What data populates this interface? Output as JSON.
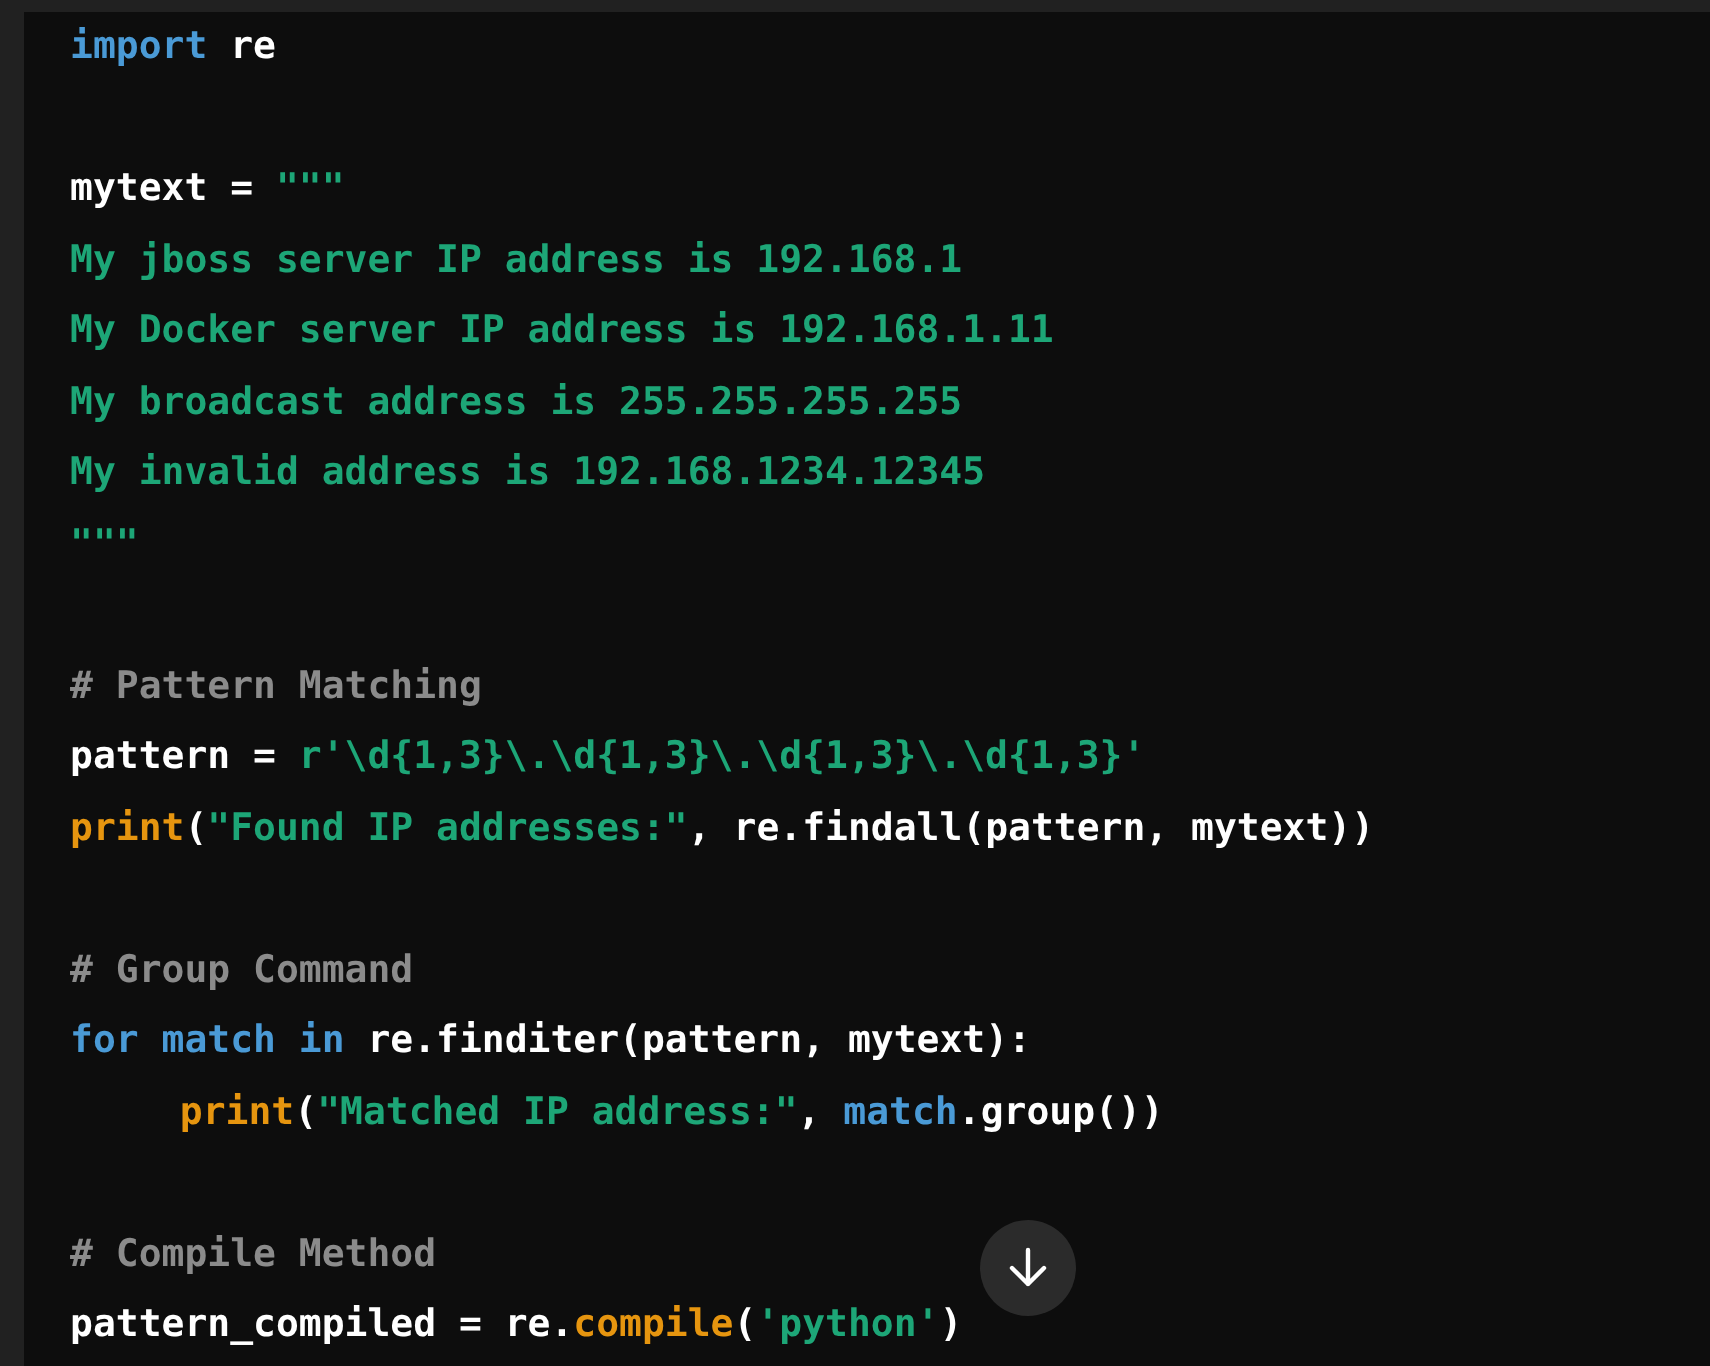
{
  "code": {
    "lines": [
      {
        "kind": "code",
        "tokens": [
          {
            "kind": "keyword",
            "text": "import"
          },
          {
            "kind": "plain",
            "text": " re"
          }
        ]
      },
      {
        "kind": "blank"
      },
      {
        "kind": "code",
        "tokens": [
          {
            "kind": "plain",
            "text": "mytext = "
          },
          {
            "kind": "string",
            "text": "\"\"\""
          }
        ]
      },
      {
        "kind": "code",
        "tokens": [
          {
            "kind": "string",
            "text": "My jboss server IP address is 192.168.1"
          }
        ]
      },
      {
        "kind": "code",
        "tokens": [
          {
            "kind": "string",
            "text": "My Docker server IP address is 192.168.1.11"
          }
        ]
      },
      {
        "kind": "code",
        "tokens": [
          {
            "kind": "string",
            "text": "My broadcast address is 255.255.255.255"
          }
        ]
      },
      {
        "kind": "code",
        "tokens": [
          {
            "kind": "string",
            "text": "My invalid address is 192.168.1234.12345"
          }
        ]
      },
      {
        "kind": "code",
        "tokens": [
          {
            "kind": "string",
            "text": "\"\"\""
          }
        ]
      },
      {
        "kind": "blank"
      },
      {
        "kind": "code",
        "tokens": [
          {
            "kind": "comment",
            "text": "# Pattern Matching"
          }
        ]
      },
      {
        "kind": "code",
        "tokens": [
          {
            "kind": "plain",
            "text": "pattern = "
          },
          {
            "kind": "string",
            "text": "r'\\d{1,3}\\.\\d{1,3}\\.\\d{1,3}\\.\\d{1,3}'"
          }
        ]
      },
      {
        "kind": "code",
        "tokens": [
          {
            "kind": "function",
            "text": "print"
          },
          {
            "kind": "plain",
            "text": "("
          },
          {
            "kind": "string",
            "text": "\"Found IP addresses:\""
          },
          {
            "kind": "plain",
            "text": ", re.findall(pattern, mytext))"
          }
        ]
      },
      {
        "kind": "blank"
      },
      {
        "kind": "code",
        "tokens": [
          {
            "kind": "comment",
            "text": "# Group Command"
          }
        ]
      },
      {
        "kind": "code",
        "tokens": [
          {
            "kind": "keyword",
            "text": "for match in"
          },
          {
            "kind": "plain",
            "text": " re.finditer(pattern, mytext):"
          }
        ]
      },
      {
        "kind": "indented",
        "tokens": [
          {
            "kind": "function",
            "text": "print"
          },
          {
            "kind": "plain",
            "text": "("
          },
          {
            "kind": "string",
            "text": "\"Matched IP address:\""
          },
          {
            "kind": "plain",
            "text": ", "
          },
          {
            "kind": "keyword",
            "text": "match"
          },
          {
            "kind": "plain",
            "text": ".group())"
          }
        ]
      },
      {
        "kind": "blank"
      },
      {
        "kind": "code",
        "tokens": [
          {
            "kind": "comment",
            "text": "# Compile Method"
          }
        ]
      },
      {
        "kind": "code",
        "tokens": [
          {
            "kind": "plain",
            "text": "pattern_compiled = re."
          },
          {
            "kind": "function",
            "text": "compile"
          },
          {
            "kind": "plain",
            "text": "("
          },
          {
            "kind": "string",
            "text": "'python'"
          },
          {
            "kind": "plain",
            "text": ")"
          }
        ]
      }
    ]
  }
}
